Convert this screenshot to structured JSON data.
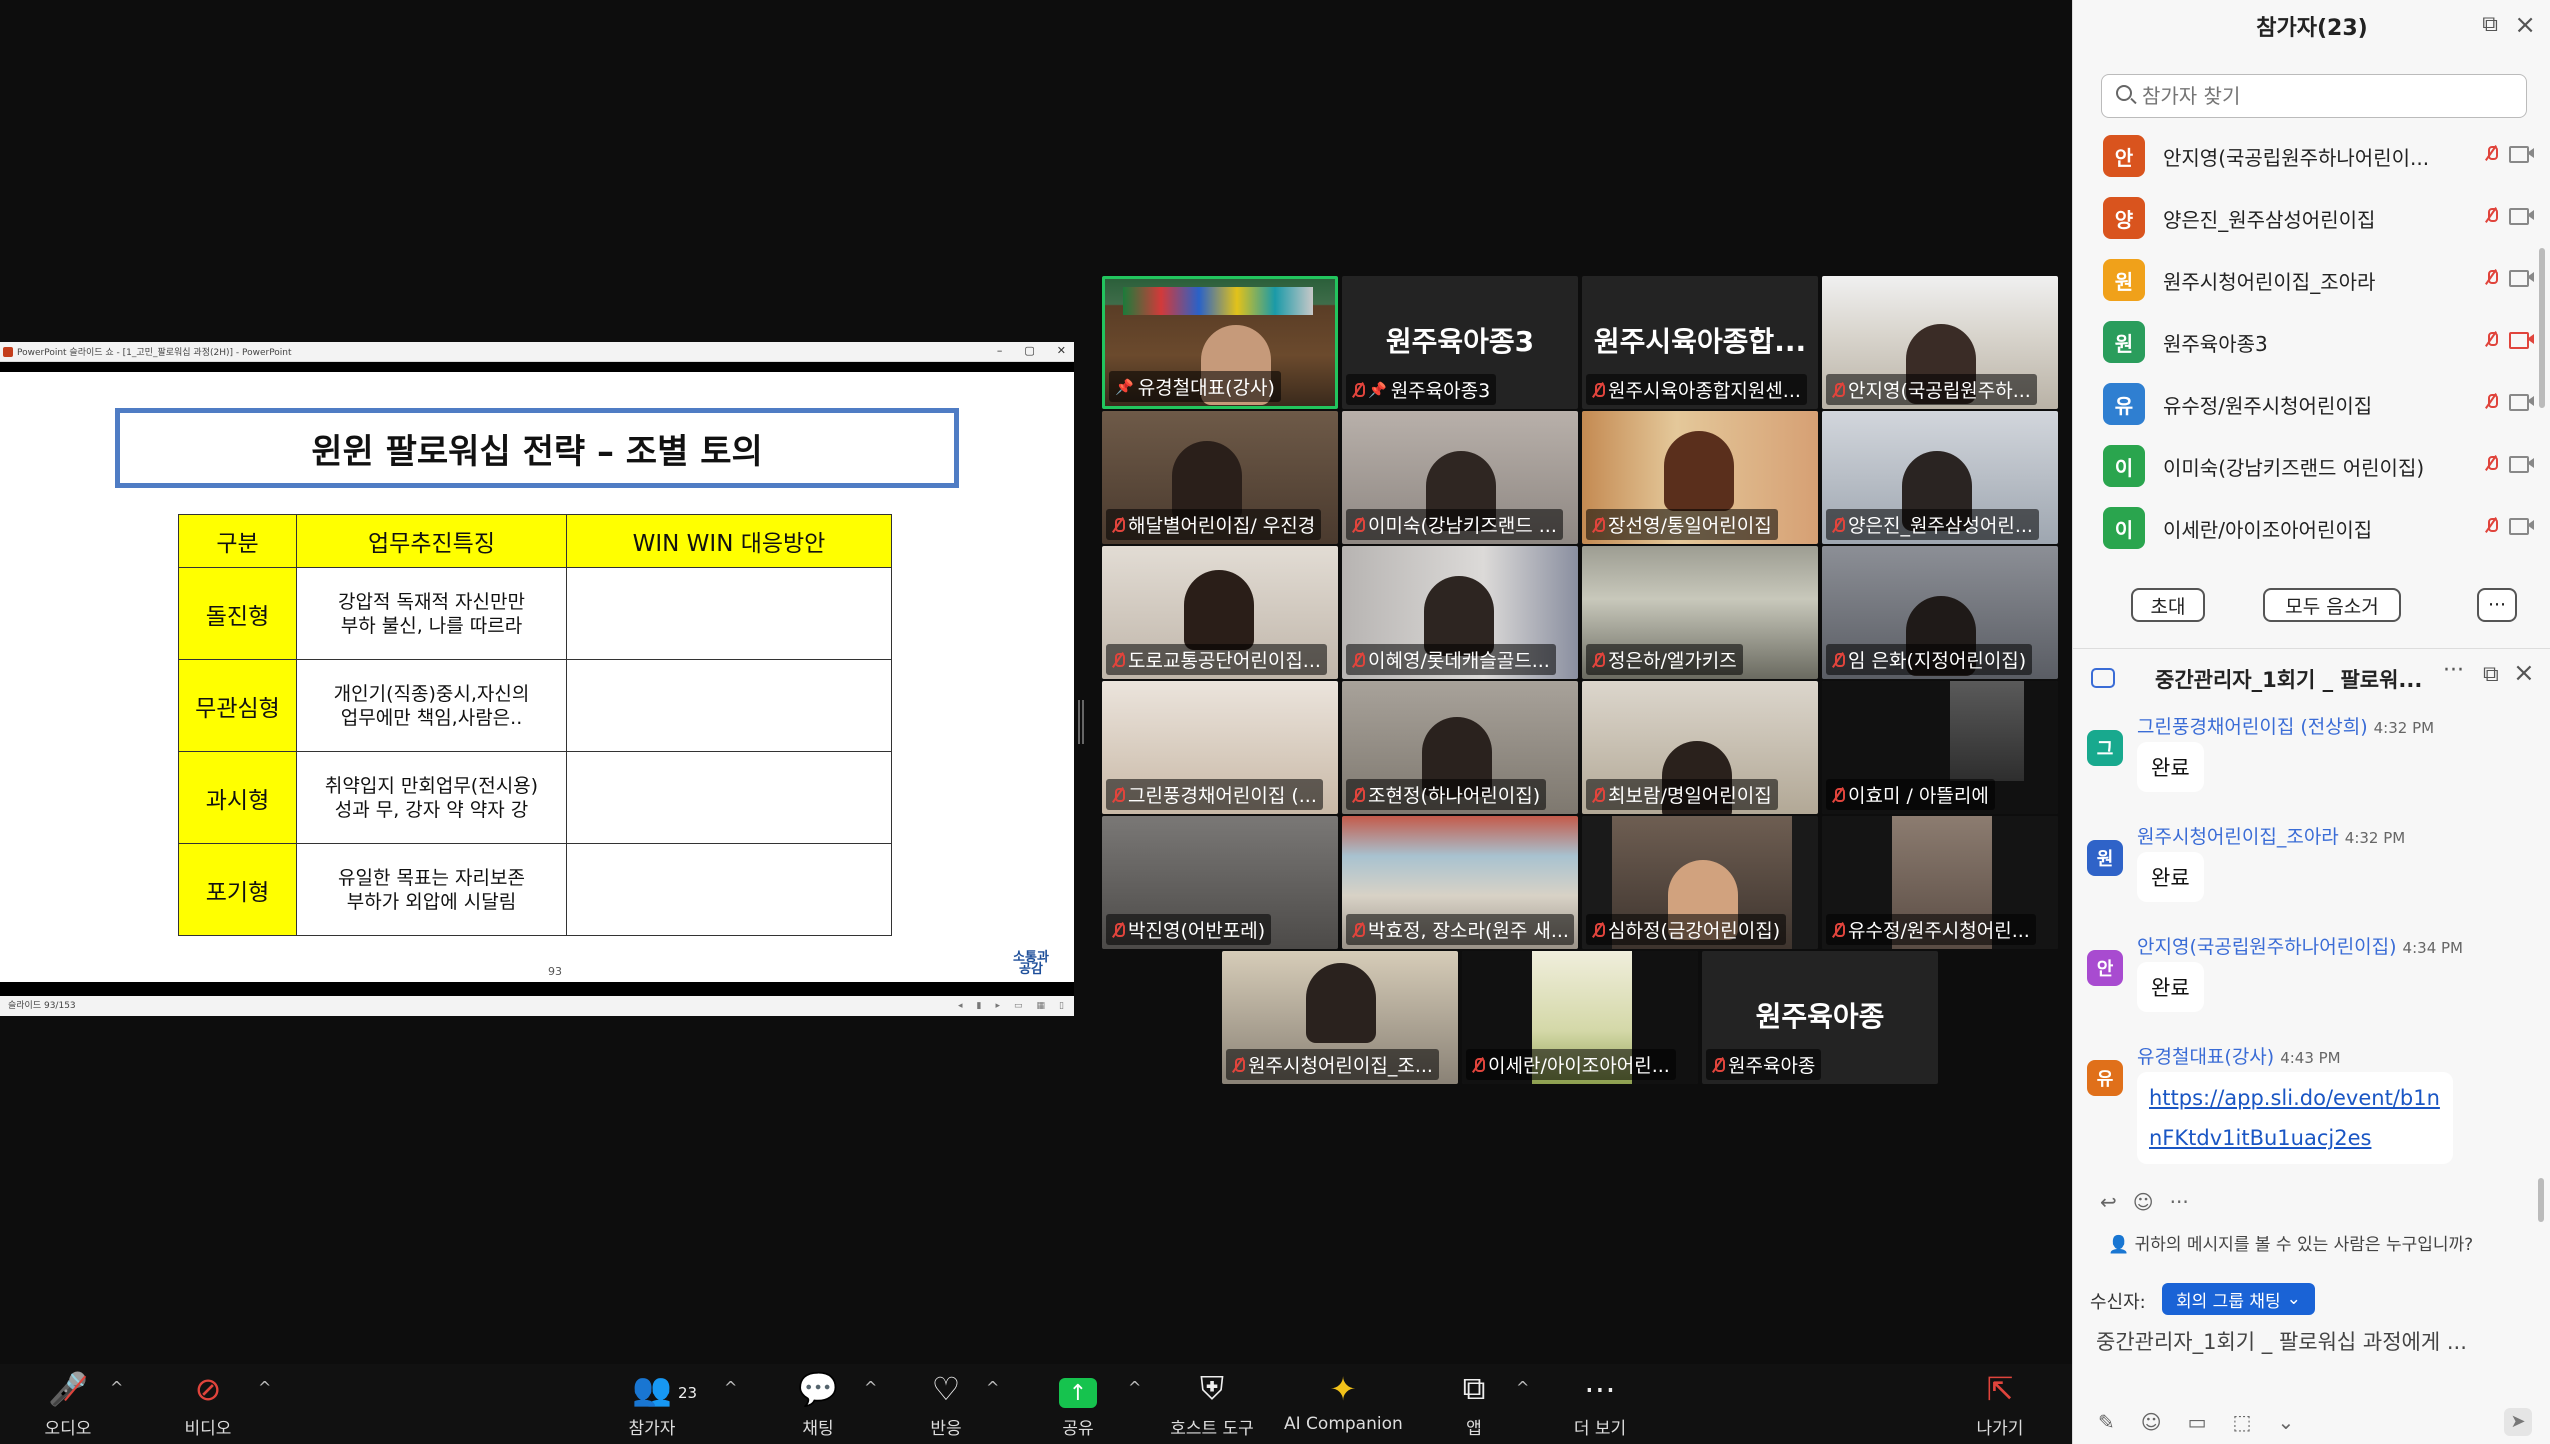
{
  "powerpoint": {
    "titlebar": "PowerPoint 슬라이드 쇼 - [1_고민_팔로워십 과정(2H)] - PowerPoint",
    "status_left": "슬라이드 93/153",
    "page_number": "93",
    "logo": "소통과 공감"
  },
  "slide": {
    "title": "윈윈 팔로워십 전략 – 조별 토의",
    "headers": [
      "구분",
      "업무추진특징",
      "WIN WIN 대응방안"
    ],
    "rows": [
      {
        "type": "돌진형",
        "feature": "강압적 독재적 자신만만\n부하 불신, 나를 따르라",
        "plan": ""
      },
      {
        "type": "무관심형",
        "feature": "개인기(직종)중시,자신의\n업무에만 책임,사람은..",
        "plan": ""
      },
      {
        "type": "과시형",
        "feature": "취약입지 만회업무(전시용)\n성과 무, 강자 약 약자 강",
        "plan": ""
      },
      {
        "type": "포기형",
        "feature": "유일한 목표는 자리보존\n부하가 외압에 시달림",
        "plan": ""
      }
    ]
  },
  "gallery": [
    {
      "name": "유경철대표(강사)",
      "video": true,
      "pinned": true,
      "muted": false,
      "active": true
    },
    {
      "name": "원주육아종3",
      "video": false,
      "pinned": true,
      "muted": true,
      "big": "원주육아종3"
    },
    {
      "name": "원주시육아종합지원센...",
      "video": false,
      "muted": true,
      "big": "원주시육아종합..."
    },
    {
      "name": "안지영(국공립원주하...",
      "video": true,
      "muted": true
    },
    {
      "name": "해달별어린이집/ 우진경",
      "video": true,
      "muted": true
    },
    {
      "name": "이미숙(강남키즈랜드 ...",
      "video": true,
      "muted": true
    },
    {
      "name": "장선영/통일어린이집",
      "video": true,
      "muted": true
    },
    {
      "name": "양은진_원주삼성어린...",
      "video": true,
      "muted": true
    },
    {
      "name": "도로교통공단어린이집...",
      "video": true,
      "muted": true
    },
    {
      "name": "이혜영/롯데캐슬골드...",
      "video": true,
      "muted": true
    },
    {
      "name": "정은하/엘가키즈",
      "video": true,
      "muted": true
    },
    {
      "name": "임 은화(지정어린이집)",
      "video": true,
      "muted": true
    },
    {
      "name": "그린풍경채어린이집 (...",
      "video": true,
      "muted": true
    },
    {
      "name": "조현정(하나어린이집)",
      "video": true,
      "muted": true
    },
    {
      "name": "최보람/명일어린이집",
      "video": true,
      "muted": true
    },
    {
      "name": "이효미 / 아뜰리에",
      "video": true,
      "muted": true
    },
    {
      "name": "박진영(어반포레)",
      "video": true,
      "muted": true
    },
    {
      "name": "박효정, 장소라(원주 새...",
      "video": true,
      "muted": true
    },
    {
      "name": "심하정(금강어린이집)",
      "video": true,
      "muted": true
    },
    {
      "name": "유수정/원주시청어린...",
      "video": true,
      "muted": true
    },
    {
      "name": "원주시청어린이집_조...",
      "video": true,
      "muted": true
    },
    {
      "name": "이세란/아이조아어린...",
      "video": true,
      "muted": true
    },
    {
      "name": "원주육아종",
      "video": false,
      "muted": true,
      "big": "원주육아종"
    }
  ],
  "participants": {
    "title": "참가자(23)",
    "search_placeholder": "참가자 찾기",
    "list": [
      {
        "initial": "안",
        "name": "안지영(국공립원주하나어린이...",
        "color": "#d9541e",
        "cam_off": false
      },
      {
        "initial": "양",
        "name": "양은진_원주삼성어린이집",
        "color": "#d9541e",
        "cam_off": false
      },
      {
        "initial": "원",
        "name": "원주시청어린이집_조아라",
        "color": "#f0a11a",
        "cam_off": false
      },
      {
        "initial": "원",
        "name": "원주육아종3",
        "color": "#2a9d5c",
        "cam_off": true
      },
      {
        "initial": "유",
        "name": "유수정/원주시청어린이집",
        "color": "#2f7fd1",
        "cam_off": false
      },
      {
        "initial": "이",
        "name": "이미숙(강남키즈랜드 어린이집)",
        "color": "#2aa54e",
        "cam_off": false
      },
      {
        "initial": "이",
        "name": "이세란/아이조아어린이집",
        "color": "#2aa54e",
        "cam_off": false
      }
    ],
    "invite": "초대",
    "mute_all": "모두 음소거",
    "more": "···"
  },
  "chat": {
    "title": "중간관리자_1회기 _ 팔로워...",
    "messages": [
      {
        "initial": "그",
        "color": "#18a98e",
        "sender": "그린풍경채어린이집 (전상희)",
        "time": "4:32 PM",
        "text": "완료"
      },
      {
        "initial": "원",
        "color": "#2f63c8",
        "sender": "원주시청어린이집_조아라",
        "time": "4:32 PM",
        "text": "완료"
      },
      {
        "initial": "안",
        "color": "#a84bd0",
        "sender": "안지영(국공립원주하나어린이집)",
        "time": "4:34 PM",
        "text": "완료"
      },
      {
        "initial": "유",
        "color": "#e0701a",
        "sender": "유경철대표(강사)",
        "time": "4:43 PM",
        "text": "https://app.sli.do/event/b1nnFKtdv1itBu1uacj2es"
      }
    ],
    "who_can_see": "귀하의 메시지를 볼 수 있는 사람은 누구입니까?",
    "recipient_label": "수신자:",
    "recipient": "회의 그룹 채팅",
    "input_placeholder": "중간관리자_1회기 _ 팔로워십 과정에게 ..."
  },
  "toolbar": {
    "audio": "오디오",
    "video": "비디오",
    "participants": "참가자",
    "participants_count": "23",
    "chat": "채팅",
    "react": "반응",
    "share": "공유",
    "host_tools": "호스트 도구",
    "ai": "AI Companion",
    "apps": "앱",
    "more": "더 보기",
    "leave": "나가기"
  }
}
